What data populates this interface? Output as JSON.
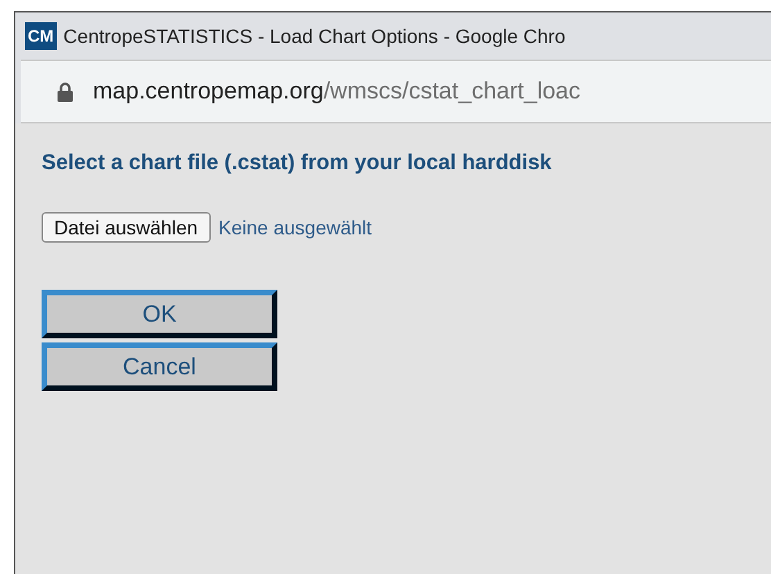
{
  "window": {
    "app_icon": "CM",
    "title": "CentropeSTATISTICS - Load Chart Options - Google Chro"
  },
  "address_bar": {
    "domain": "map.centropemap.org",
    "path": "/wmscs/cstat_chart_loac"
  },
  "heading": "Select a chart file (.cstat) from your local harddisk",
  "file_input": {
    "button": "Datei auswählen",
    "status": "Keine ausgewählt"
  },
  "buttons": [
    "OK",
    "Cancel"
  ]
}
